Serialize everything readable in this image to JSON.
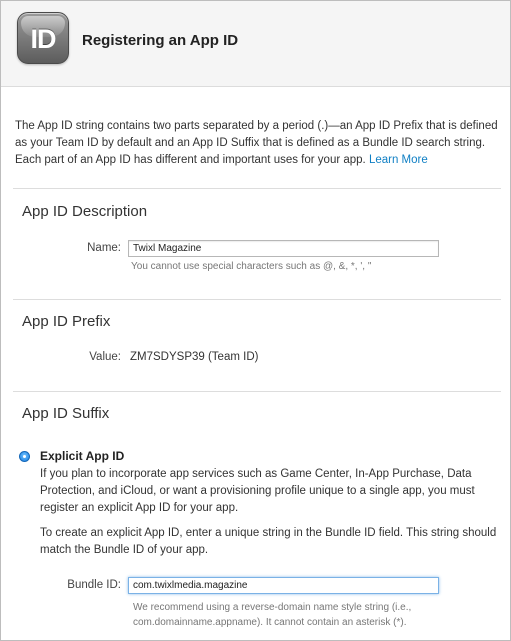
{
  "header": {
    "icon_glyph": "ID",
    "title": "Registering an App ID"
  },
  "intro": {
    "text": "The App ID string contains two parts separated by a period (.)—an App ID Prefix that is defined as your Team ID by default and an App ID Suffix that is defined as a Bundle ID search string. Each part of an App ID has different and important uses for your app.",
    "link": "Learn More"
  },
  "description": {
    "title": "App ID Description",
    "name_label": "Name:",
    "name_value": "Twixl Magazine",
    "name_hint": "You cannot use special characters such as @, &, *, ', \""
  },
  "prefix": {
    "title": "App ID Prefix",
    "value_label": "Value:",
    "value": "ZM7SDYSP39 (Team ID)"
  },
  "suffix": {
    "title": "App ID Suffix",
    "option_label": "Explicit App ID",
    "para1": "If you plan to incorporate app services such as Game Center, In-App Purchase, Data Protection, and iCloud, or want a provisioning profile unique to a single app, you must register an explicit App ID for your app.",
    "para2": "To create an explicit App ID, enter a unique string in the Bundle ID field. This string should match the Bundle ID of your app.",
    "bundle_label": "Bundle ID:",
    "bundle_value": "com.twixlmedia.magazine",
    "bundle_hint_1": "We recommend using a reverse-domain name style string (i.e.,",
    "bundle_hint_2": "com.domainname.appname). It cannot contain an asterisk (*)."
  },
  "colors": {
    "link": "#0f7fc4",
    "radio": "#1a7fe0",
    "focus": "#7bb2e6"
  }
}
